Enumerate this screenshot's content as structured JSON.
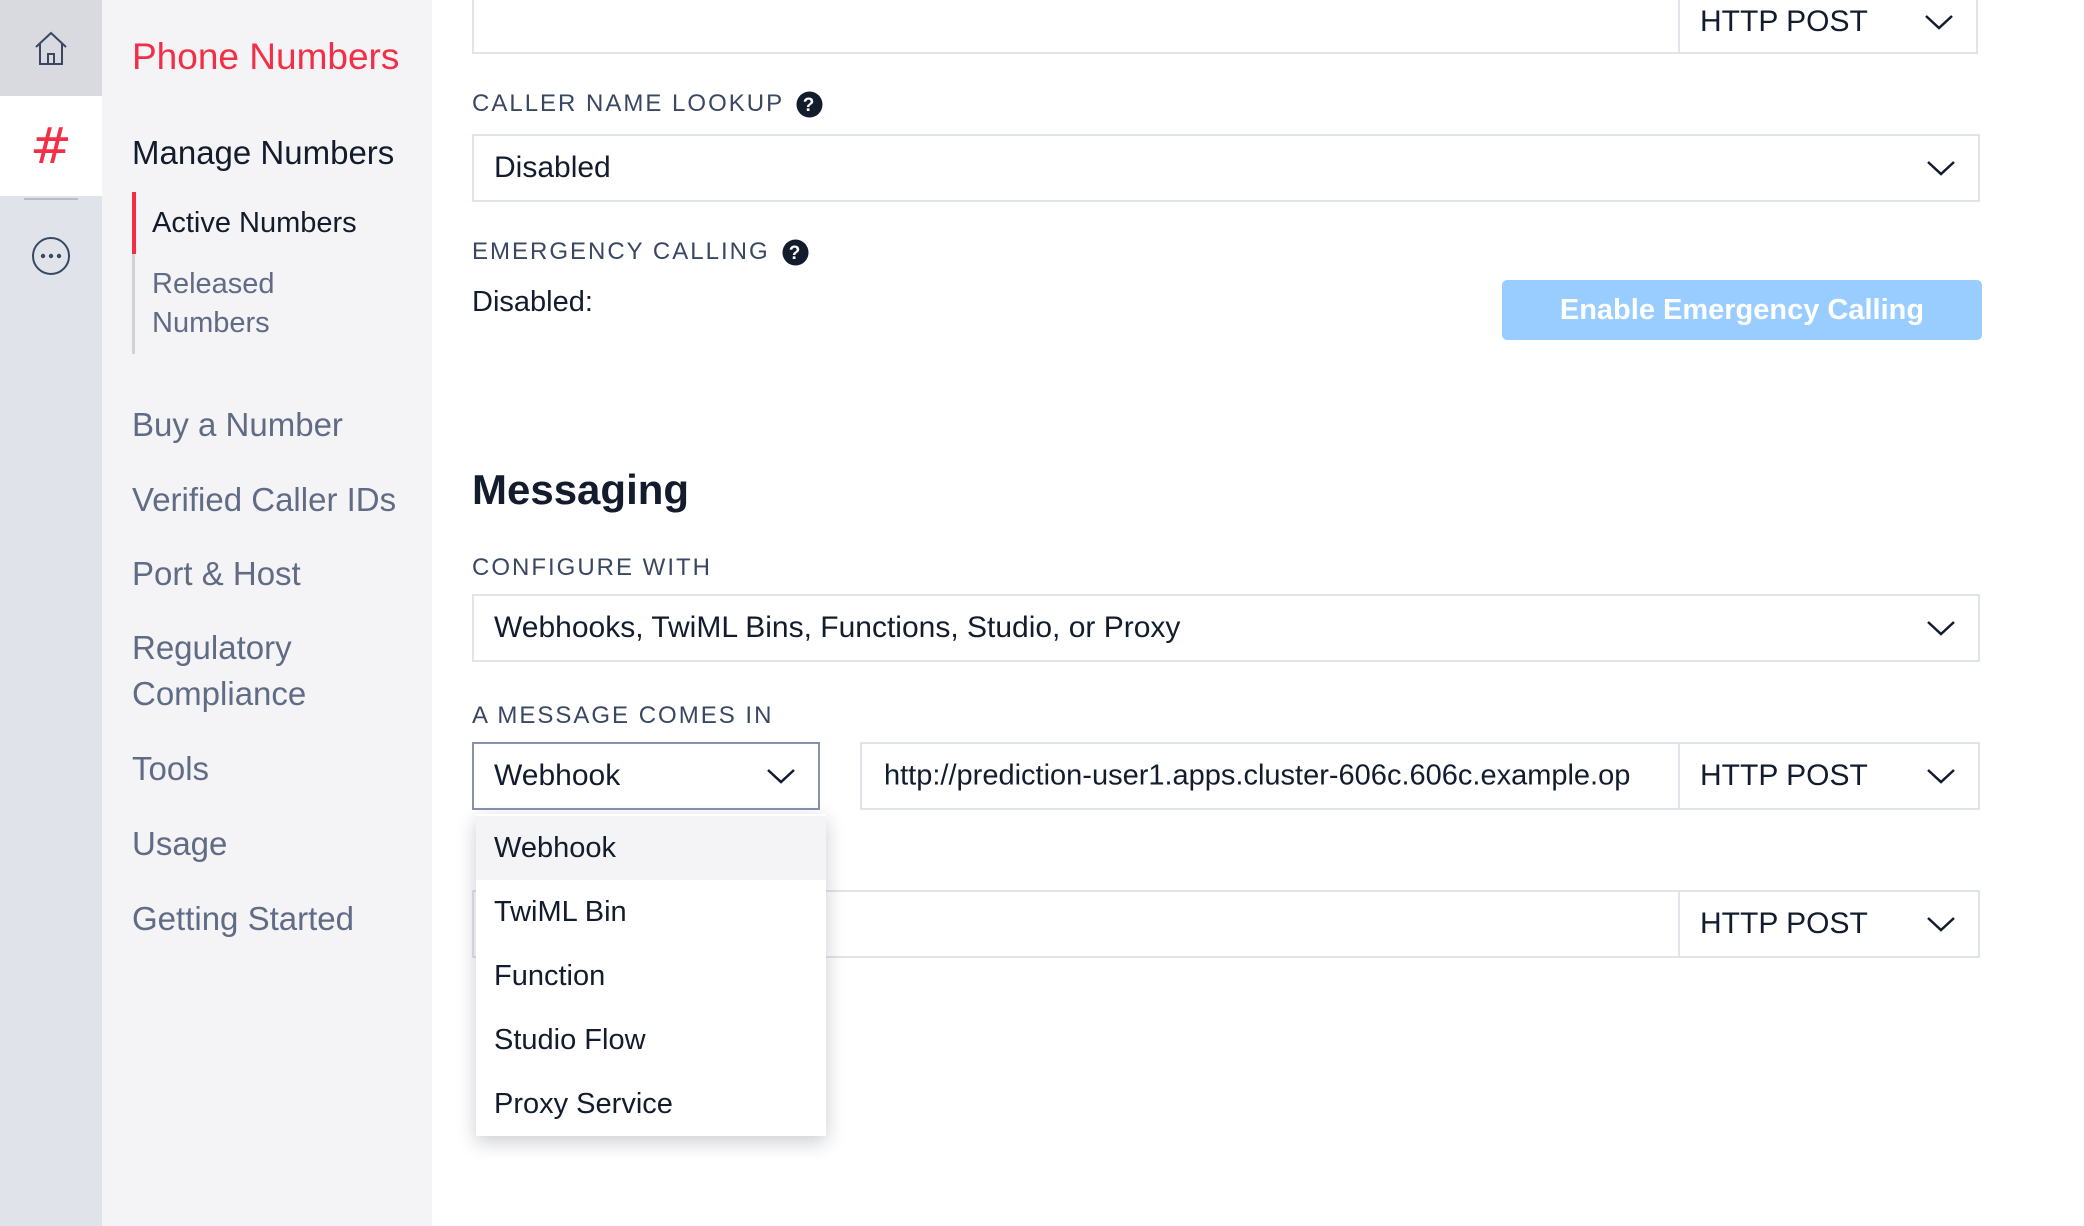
{
  "rail": {
    "icons": [
      "home-icon",
      "hash-icon",
      "more-icon"
    ]
  },
  "subnav": {
    "title": "Phone Numbers",
    "section": "Manage Numbers",
    "sub_items": [
      {
        "label": "Active Numbers",
        "active": true
      },
      {
        "label": "Released\nNumbers",
        "active": false
      }
    ],
    "items": [
      "Buy a Number",
      "Verified Caller IDs",
      "Port & Host",
      "Regulatory\nCompliance",
      "Tools",
      "Usage",
      "Getting Started"
    ]
  },
  "voice": {
    "top_method": "HTTP POST",
    "caller_name_lookup_label": "CALLER NAME LOOKUP",
    "caller_name_lookup_value": "Disabled",
    "emergency_label": "EMERGENCY CALLING",
    "emergency_status": "Disabled:",
    "enable_emergency_button": "Enable Emergency Calling"
  },
  "messaging": {
    "heading": "Messaging",
    "configure_label": "CONFIGURE WITH",
    "configure_value": "Webhooks, TwiML Bins, Functions, Studio, or Proxy",
    "message_in_label": "A MESSAGE COMES IN",
    "message_in_type": "Webhook",
    "message_in_url": "http://prediction-user1.apps.cluster-606c.606c.example.op",
    "message_in_method": "HTTP POST",
    "fail_method": "HTTP POST",
    "dropdown_options": [
      "Webhook",
      "TwiML Bin",
      "Function",
      "Studio Flow",
      "Proxy Service"
    ],
    "dropdown_highlighted": "Webhook"
  },
  "colors": {
    "brand_red": "#f22f46",
    "button_disabled_blue": "#99cdff",
    "rail_bg": "#e1e3ea",
    "subnav_bg": "#f4f4f6"
  }
}
